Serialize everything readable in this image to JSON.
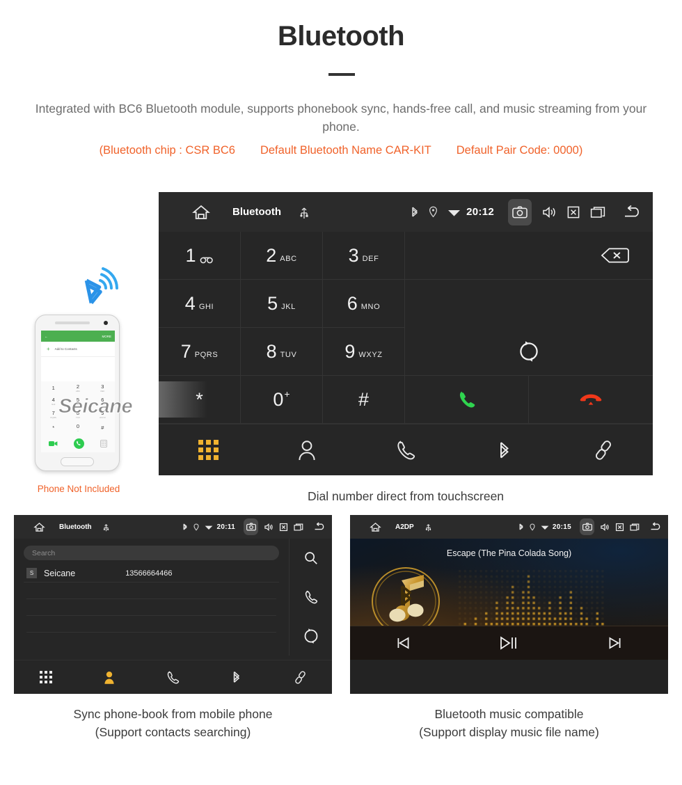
{
  "header": {
    "title": "Bluetooth",
    "description": "Integrated with BC6 Bluetooth module, supports phonebook sync, hands-free call, and music streaming from your phone.",
    "specs": [
      "(Bluetooth chip : CSR BC6",
      "Default Bluetooth Name CAR-KIT",
      "Default Pair Code: 0000)"
    ],
    "accent_color": "#f0622a",
    "text_color": "#6d6d6d"
  },
  "dialer_screen": {
    "statusbar": {
      "home_icon": "home-icon",
      "title": "Bluetooth",
      "usb_icon": "usb-icon",
      "bluetooth_icon": "bluetooth-icon",
      "location_icon": "location-pin-icon",
      "wifi_icon": "wifi-icon",
      "time": "20:12",
      "camera_icon": "camera-icon",
      "volume_icon": "volume-icon",
      "close_icon": "close-box-icon",
      "recents_icon": "recent-apps-icon",
      "back_icon": "back-arrow-icon"
    },
    "keys": [
      {
        "num": "1",
        "sub": "",
        "glyph": "voicemail"
      },
      {
        "num": "2",
        "sub": "ABC"
      },
      {
        "num": "3",
        "sub": "DEF"
      },
      {
        "num": "4",
        "sub": "GHI"
      },
      {
        "num": "5",
        "sub": "JKL"
      },
      {
        "num": "6",
        "sub": "MNO"
      },
      {
        "num": "7",
        "sub": "PQRS"
      },
      {
        "num": "8",
        "sub": "TUV"
      },
      {
        "num": "9",
        "sub": "WXYZ"
      },
      {
        "num": "*",
        "sub": ""
      },
      {
        "num": "0",
        "sup": "+"
      },
      {
        "num": "#",
        "sub": ""
      }
    ],
    "actions": {
      "backspace_icon": "backspace-icon",
      "sync_icon": "sync-icon",
      "call_icon": "call-answer-icon",
      "hangup_icon": "call-end-icon",
      "call_color": "#2fd44f",
      "hangup_color": "#f0381a"
    },
    "bottom_nav": [
      {
        "icon": "keypad-icon",
        "active": true
      },
      {
        "icon": "contacts-icon",
        "active": false
      },
      {
        "icon": "call-log-icon",
        "active": false
      },
      {
        "icon": "bluetooth-icon",
        "active": false
      },
      {
        "icon": "link-icon",
        "active": false
      }
    ],
    "active_color": "#f0b330",
    "caption": "Dial number direct from touchscreen"
  },
  "phone_mockup": {
    "appbar_back_icon": "back-arrow-icon",
    "appbar_more_label": "MORE",
    "add_to_contacts_label": "Add to Contacts",
    "keys": [
      {
        "num": "1",
        "sub": ""
      },
      {
        "num": "2",
        "sub": "ABC"
      },
      {
        "num": "3",
        "sub": "DEF"
      },
      {
        "num": "4",
        "sub": "GHI"
      },
      {
        "num": "5",
        "sub": "JKL"
      },
      {
        "num": "6",
        "sub": "MNO"
      },
      {
        "num": "7",
        "sub": "PQRS"
      },
      {
        "num": "8",
        "sub": "TUV"
      },
      {
        "num": "9",
        "sub": "WXYZ"
      },
      {
        "num": "*",
        "sub": ""
      },
      {
        "num": "0",
        "sub": "+"
      },
      {
        "num": "#",
        "sub": ""
      }
    ],
    "call_icon": "call-answer-icon",
    "video_icon": "video-call-icon",
    "keyboard_icon": "keyboard-icon",
    "bluetooth_illustration_icon": "bluetooth-signal-icon",
    "bluetooth_illustration_color": "#2b93e8",
    "watermark": "Seicane",
    "disclaimer": "Phone Not Included"
  },
  "phonebook_screen": {
    "statusbar": {
      "home_icon": "home-icon",
      "title": "Bluetooth",
      "usb_icon": "usb-icon",
      "time": "20:11",
      "camera_icon": "camera-icon",
      "volume_icon": "volume-icon",
      "close_icon": "close-box-icon",
      "recents_icon": "recent-apps-icon",
      "back_icon": "back-arrow-icon"
    },
    "search_placeholder": "Search",
    "contacts": [
      {
        "initial": "S",
        "name": "Seicane",
        "number": "13566664466"
      }
    ],
    "rail": [
      {
        "icon": "search-icon"
      },
      {
        "icon": "call-log-icon"
      },
      {
        "icon": "sync-icon"
      }
    ],
    "bottom_nav": [
      {
        "icon": "keypad-icon",
        "active": false
      },
      {
        "icon": "contacts-icon",
        "active": true
      },
      {
        "icon": "call-log-icon",
        "active": false
      },
      {
        "icon": "bluetooth-icon",
        "active": false
      },
      {
        "icon": "link-icon",
        "active": false
      }
    ],
    "caption_line1": "Sync phone-book from mobile phone",
    "caption_line2": "(Support contacts searching)"
  },
  "music_screen": {
    "statusbar": {
      "home_icon": "home-icon",
      "title": "A2DP",
      "usb_icon": "usb-icon",
      "time": "20:15",
      "camera_icon": "camera-icon",
      "volume_icon": "volume-icon",
      "close_icon": "close-box-icon",
      "recents_icon": "recent-apps-icon",
      "back_icon": "back-arrow-icon"
    },
    "song_title": "Escape (The Pina Colada Song)",
    "album_art_icon": "music-note-bluetooth-icon",
    "equalizer_icon": "dot-matrix-equalizer",
    "accent_gold": "#c9962e",
    "controls": [
      {
        "icon": "previous-track-icon"
      },
      {
        "icon": "play-pause-icon"
      },
      {
        "icon": "next-track-icon"
      }
    ],
    "caption_line1": "Bluetooth music compatible",
    "caption_line2": "(Support display music file name)"
  }
}
